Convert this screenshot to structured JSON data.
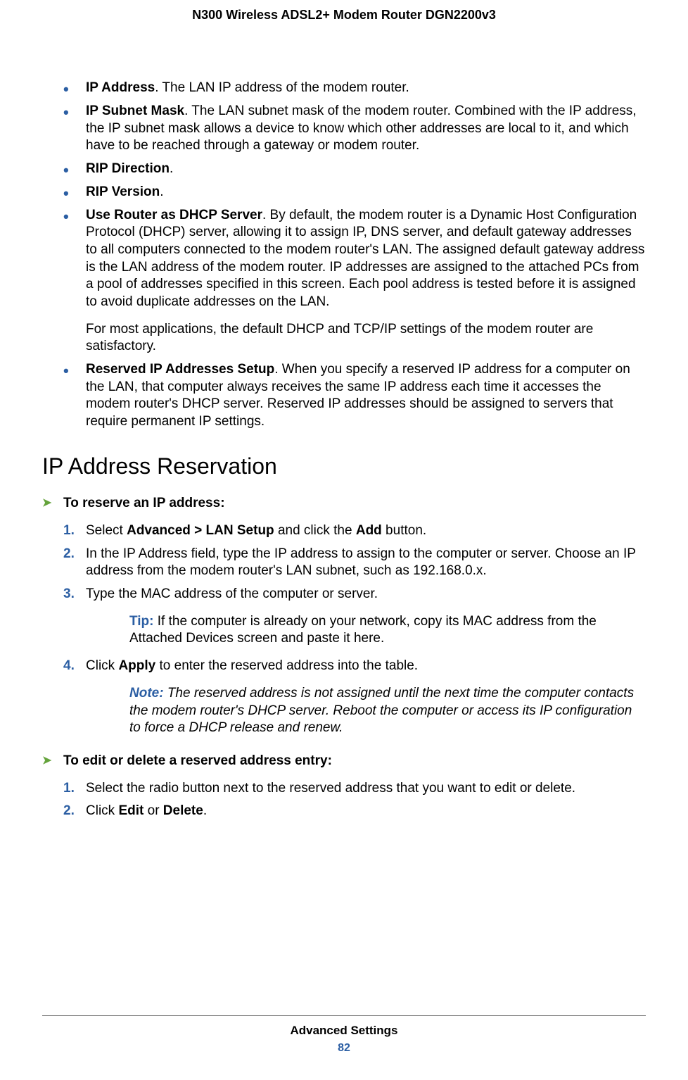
{
  "header": "N300 Wireless ADSL2+ Modem Router DGN2200v3",
  "bullets": [
    {
      "term": "IP Address",
      "text": ". The LAN IP address of the modem router."
    },
    {
      "term": "IP Subnet Mask",
      "text": ". The LAN subnet mask of the modem router. Combined with the IP address, the IP subnet mask allows a device to know which other addresses are local to it, and which have to be reached through a gateway or modem router."
    },
    {
      "term": "RIP Direction",
      "text": "."
    },
    {
      "term": "RIP Version",
      "text": "."
    },
    {
      "term": "Use Router as DHCP Server",
      "text": ". By default, the modem router is a Dynamic Host Configuration Protocol (DHCP) server, allowing it to assign IP, DNS server, and default gateway addresses to all computers connected to the modem router's LAN. The assigned default gateway address is the LAN address of the modem router. IP addresses are assigned to the attached PCs from a pool of addresses specified in this screen. Each pool address is tested before it is assigned to avoid duplicate addresses on the LAN.",
      "extra": "For most applications, the default DHCP and TCP/IP settings of the modem router are satisfactory."
    },
    {
      "term": "Reserved IP Addresses Setup",
      "text": ". When you specify a reserved IP address for a computer on the LAN, that computer always receives the same IP address each time it accesses the modem router's DHCP server. Reserved IP addresses should be assigned to servers that require permanent IP settings."
    }
  ],
  "section_heading": "IP Address Reservation",
  "proc1_title": "To reserve an IP address:",
  "proc1_steps": {
    "s1_pre": "Select ",
    "s1_b1": "Advanced > LAN Setup",
    "s1_mid": " and click the ",
    "s1_b2": "Add",
    "s1_post": " button.",
    "s2": "In the IP Address field, type the IP address to assign to the computer or server. Choose an IP address from the modem router's LAN subnet, such as 192.168.0.x.",
    "s3": "Type the MAC address of the computer or server.",
    "tip_label": "Tip:  ",
    "tip_text": "If the computer is already on your network, copy its MAC address from the Attached Devices screen and paste it here.",
    "s4_pre": "Click ",
    "s4_b1": "Apply",
    "s4_post": " to enter the reserved address into the table.",
    "note_label": "Note:  ",
    "note_text": "The reserved address is not assigned until the next time the computer contacts the modem router's DHCP server. Reboot the computer or access its IP configuration to force a DHCP release and renew."
  },
  "proc2_title": "To edit or delete a reserved address entry:",
  "proc2_steps": {
    "s1": "Select the radio button next to the reserved address that you want to edit or delete.",
    "s2_pre": "Click ",
    "s2_b1": "Edit",
    "s2_mid": " or ",
    "s2_b2": "Delete",
    "s2_post": "."
  },
  "footer_title": "Advanced Settings",
  "footer_page": "82"
}
